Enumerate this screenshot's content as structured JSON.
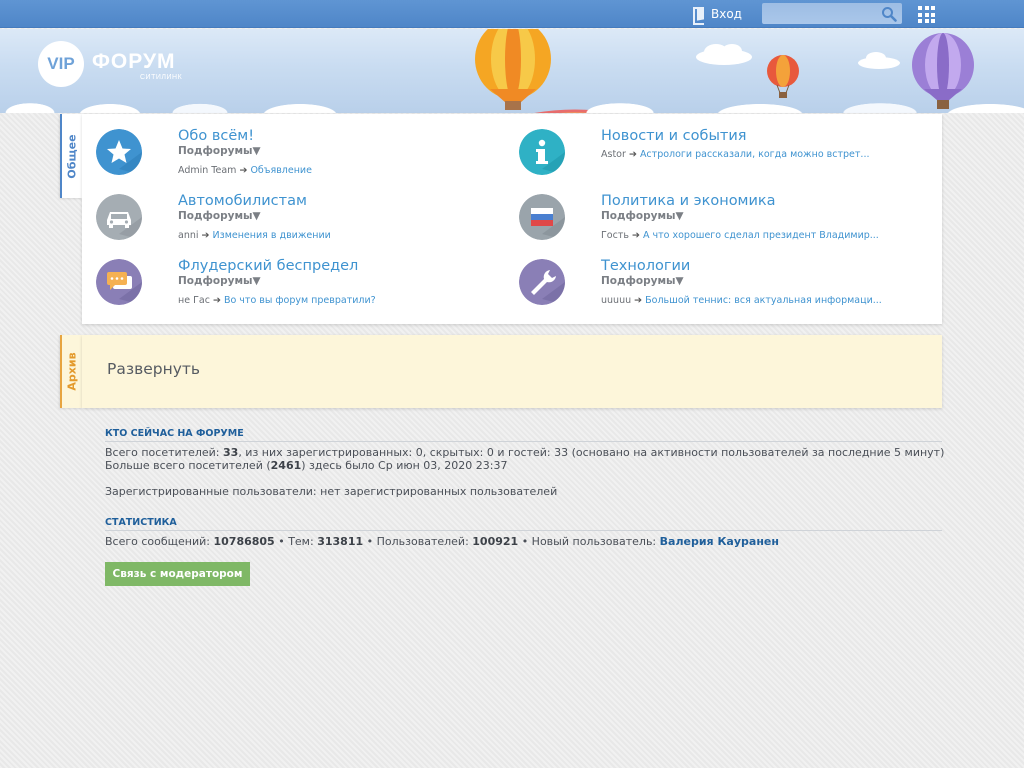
{
  "topbar": {
    "login_label": "Вход",
    "search_placeholder": "",
    "icons": [
      "door-icon",
      "search-icon",
      "apps-grid-icon"
    ]
  },
  "header": {
    "logo_vip": "VIP",
    "logo_forum": "ФОРУМ",
    "logo_sub": "СИТИЛИНК"
  },
  "tabs": {
    "general": "Общее",
    "archive": "Архив"
  },
  "forums": [
    {
      "title": "Обо всём!",
      "subforums": "Подфорумы▼",
      "last_user": "Admin Team",
      "last_topic": "Объявление",
      "icon": "star-icon",
      "color": "#3f93d0"
    },
    {
      "title": "Новости и события",
      "subforums": "",
      "last_user": "Astor",
      "last_topic": "Астрологи рассказали, когда можно встрет...",
      "icon": "info-icon",
      "color": "#2fb1c5"
    },
    {
      "title": "Автомобилистам",
      "subforums": "Подфорумы▼",
      "last_user": "anni",
      "last_topic": "Изменения в движении",
      "icon": "car-icon",
      "color": "#a5adb3"
    },
    {
      "title": "Политика и экономика",
      "subforums": "Подфорумы▼",
      "last_user": "Гость",
      "last_topic": "А что хорошего сделал президент Владимир...",
      "icon": "flag-icon",
      "color": "#9aa4ab"
    },
    {
      "title": "Флудерский беспредел",
      "subforums": "Подфорумы▼",
      "last_user": "не Гас",
      "last_topic": "Во что вы форум превратили?",
      "icon": "chat-icon",
      "color": "#8a7fb6"
    },
    {
      "title": "Технологии",
      "subforums": "Подфорумы▼",
      "last_user": "uuuuu",
      "last_topic": "Большой теннис: вся актуальная информаци...",
      "icon": "wrench-icon",
      "color": "#8a7fb6"
    }
  ],
  "archive": {
    "expand_label": "Развернуть"
  },
  "online": {
    "title": "КТО СЕЙЧАС НА ФОРУМЕ",
    "line1_pre": "Всего посетителей: ",
    "line1_count": "33",
    "line1_post": ", из них зарегистрированных: 0, скрытых: 0 и гостей: 33 (основано на активности пользователей за последние 5 минут)",
    "line2_pre": "Больше всего посетителей (",
    "line2_count": "2461",
    "line2_post": ") здесь было Ср июн 03, 2020 23:37",
    "line3": "Зарегистрированные пользователи: нет зарегистрированных пользователей"
  },
  "stats": {
    "title": "СТАТИСТИКА",
    "posts_label": "Всего сообщений: ",
    "posts": "10786805",
    "topics_label": " • Тем: ",
    "topics": "313811",
    "users_label": " • Пользователей: ",
    "users": "100921",
    "newuser_label": " • Новый пользователь: ",
    "newuser": "Валерия Кауранен"
  },
  "moderator_button": "Связь с модератором"
}
